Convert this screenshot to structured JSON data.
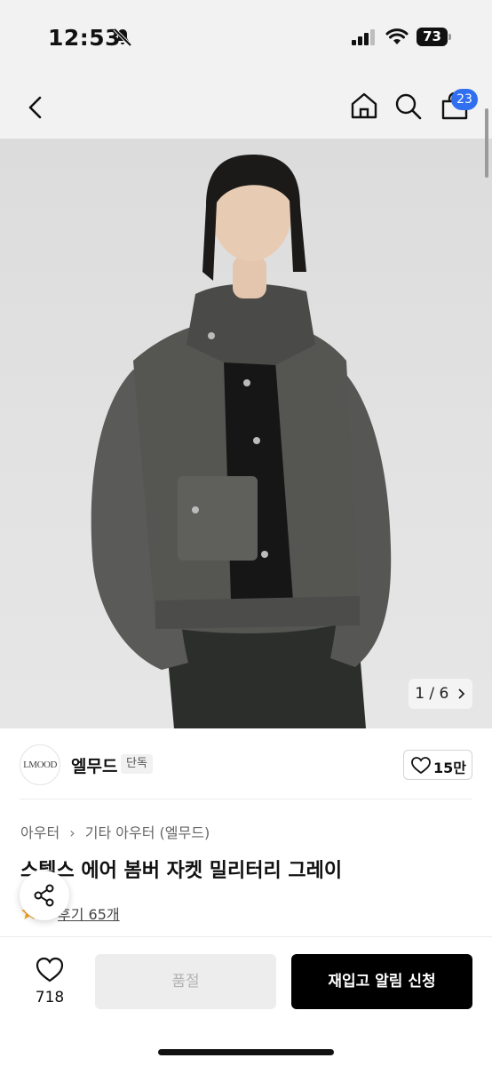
{
  "status_bar": {
    "time": "12:53",
    "battery": "73",
    "icons": [
      "bell-off-icon",
      "signal-icon",
      "wifi-icon",
      "battery-icon"
    ]
  },
  "nav": {
    "icons": [
      "back-icon",
      "home-icon",
      "search-icon",
      "cart-icon"
    ],
    "cart_count": "23"
  },
  "gallery": {
    "counter": "1 / 6",
    "counter_icon": "chevron-right-icon"
  },
  "brand": {
    "logo_text": "LMOOD",
    "name": "엘무드",
    "tag": "단독",
    "likes": "15만"
  },
  "breadcrumb": [
    "아우터",
    "기타 아우터 (엘무드)"
  ],
  "product": {
    "title": "스텔스 에어 봄버 자켓 밀리터리 그레이",
    "rating_score": "5",
    "review_link": "후기 65개"
  },
  "bottom": {
    "wish_count": "718",
    "soldout_label": "품절",
    "restock_label": "재입고 알림 신청"
  },
  "colors": {
    "accent_badge": "#2f6ff0",
    "star": "#f5a623",
    "primary_button": "#000000",
    "disabled_button": "#ededed"
  }
}
